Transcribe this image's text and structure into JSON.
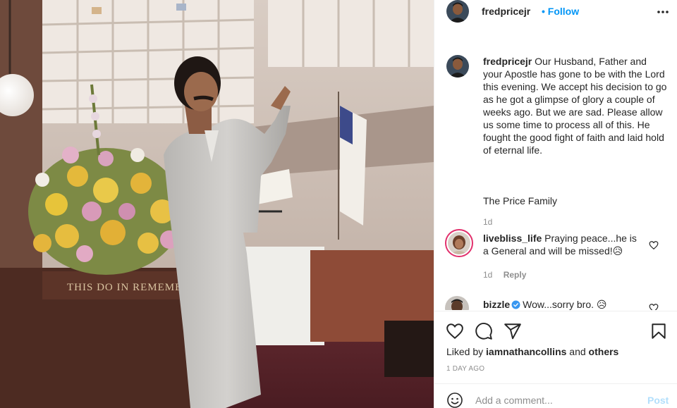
{
  "post": {
    "author": "fredpricejr",
    "separator": "•",
    "follow_label": "Follow",
    "image_alt": "Vintage photograph of a preacher in a light suit speaking at a pulpit beside a large flower arrangement",
    "pulpit_inscription": "THIS DO IN REMEMBRANCE"
  },
  "caption": {
    "username": "fredpricejr",
    "text": "Our Husband, Father and your Apostle has gone to be with the Lord this evening. We accept his decision to go as he got a glimpse of glory a couple of weeks ago. But we are sad. Please allow us some time to process all of this. He fought the good fight of faith and laid hold of eternal life.",
    "signature": "The Price Family",
    "age": "1d"
  },
  "comments": [
    {
      "username": "livebliss_life",
      "text": "Praying peace...he is a General and will be missed!😥",
      "age": "1d",
      "reply_label": "Reply"
    },
    {
      "username": "bizzle",
      "text": "Wow...sorry bro. 😥"
    }
  ],
  "likes": {
    "prefix": "Liked by",
    "user": "iamnathancollins",
    "joiner": "and",
    "others": "others"
  },
  "date_label": "1 DAY AGO",
  "add_comment": {
    "placeholder": "Add a comment...",
    "post_label": "Post"
  },
  "icons": {
    "more": "more-options-icon",
    "like": "heart-icon",
    "comment": "comment-icon",
    "share": "share-icon",
    "save": "bookmark-icon",
    "emoji": "emoji-icon",
    "verified": "verified-badge-icon"
  },
  "colors": {
    "link": "#0095f6",
    "text": "#262626",
    "muted": "#8e8e8e",
    "post_disabled": "#b2dffc",
    "verified": "#3897f0"
  }
}
